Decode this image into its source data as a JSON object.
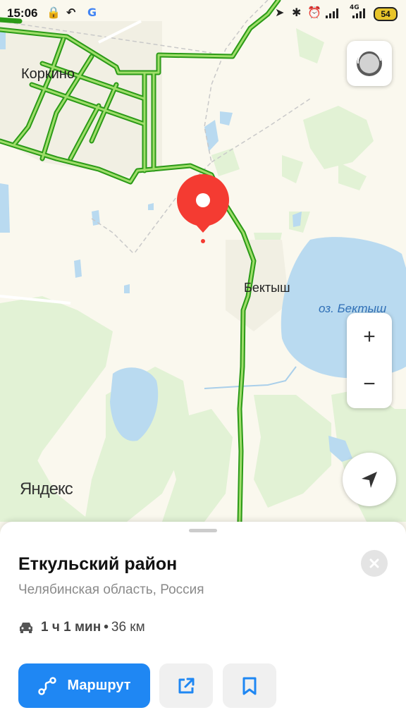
{
  "status_bar": {
    "time": "15:06",
    "network_label": "4G",
    "battery_level": "54"
  },
  "map": {
    "labels": {
      "town_1": "Коркино",
      "village_1": "Бектыш",
      "lake_1": "оз. Бектыш"
    },
    "watermark": "Яндекс",
    "zoom_in_label": "+",
    "zoom_out_label": "−"
  },
  "place_card": {
    "title": "Еткульский район",
    "subtitle": "Челябинская область, Россия",
    "travel_time": "1 ч 1 мин",
    "separator": "•",
    "distance": "36 км",
    "route_button_label": "Маршрут"
  },
  "colors": {
    "accent": "#1f87f3",
    "traffic_green": "#3fb31f",
    "pin_red": "#f43b32",
    "water": "#b9daf0",
    "forest": "#e2f2d5"
  }
}
